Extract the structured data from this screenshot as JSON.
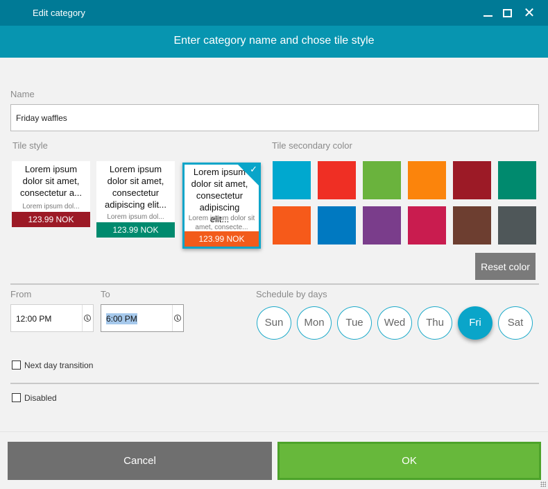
{
  "window": {
    "title": "Edit category",
    "minimize_icon": "minimize-icon",
    "maximize_icon": "maximize-icon",
    "close_icon": "close-icon",
    "close_glyph": "✕"
  },
  "header": {
    "subtitle": "Enter category name and chose tile style"
  },
  "name": {
    "label": "Name",
    "value": "Friday waffles"
  },
  "tile_style": {
    "label": "Tile style",
    "tiles": [
      {
        "title": "Lorem ipsum dolor sit amet, consectetur a...",
        "desc": "Lorem ipsum dol...",
        "price": "123.99 NOK",
        "price_color": "#9c1a26",
        "selected": false
      },
      {
        "title": "Lorem ipsum dolor sit amet, consectetur adipiscing elit...",
        "desc": "Lorem ipsum dol...",
        "price": "123.99 NOK",
        "price_color": "#008a6e",
        "selected": false
      },
      {
        "title": "Lorem ipsum dolor sit amet, consectetur adipiscing elit...",
        "desc": "Lorem ipsum dolor sit amet, consecte...",
        "price": "123.99 NOK",
        "price_color": "#f25b1b",
        "selected": true
      }
    ],
    "selected_check_icon": "checkmark-icon",
    "check_glyph": "✓"
  },
  "secondary_color": {
    "label": "Tile secondary color",
    "swatches": [
      "#00a8cf",
      "#ef2f24",
      "#6ab33d",
      "#fb840c",
      "#9c1a26",
      "#008a6e",
      "#f65a1a",
      "#0079c1",
      "#7a3d8b",
      "#c91c4f",
      "#6d3e30",
      "#4f5759"
    ],
    "reset_label": "Reset color"
  },
  "time": {
    "from_label": "From",
    "from_value": "12:00 PM",
    "to_label": "To",
    "to_value": "6:00 PM",
    "clock_icon": "clock-icon"
  },
  "schedule": {
    "label": "Schedule by days",
    "days": [
      "Sun",
      "Mon",
      "Tue",
      "Wed",
      "Thu",
      "Fri",
      "Sat"
    ],
    "active_day": "Fri"
  },
  "options": {
    "next_day_label": "Next day transition",
    "next_day_checked": false,
    "disabled_label": "Disabled",
    "disabled_checked": false
  },
  "footer": {
    "cancel_label": "Cancel",
    "ok_label": "OK"
  }
}
